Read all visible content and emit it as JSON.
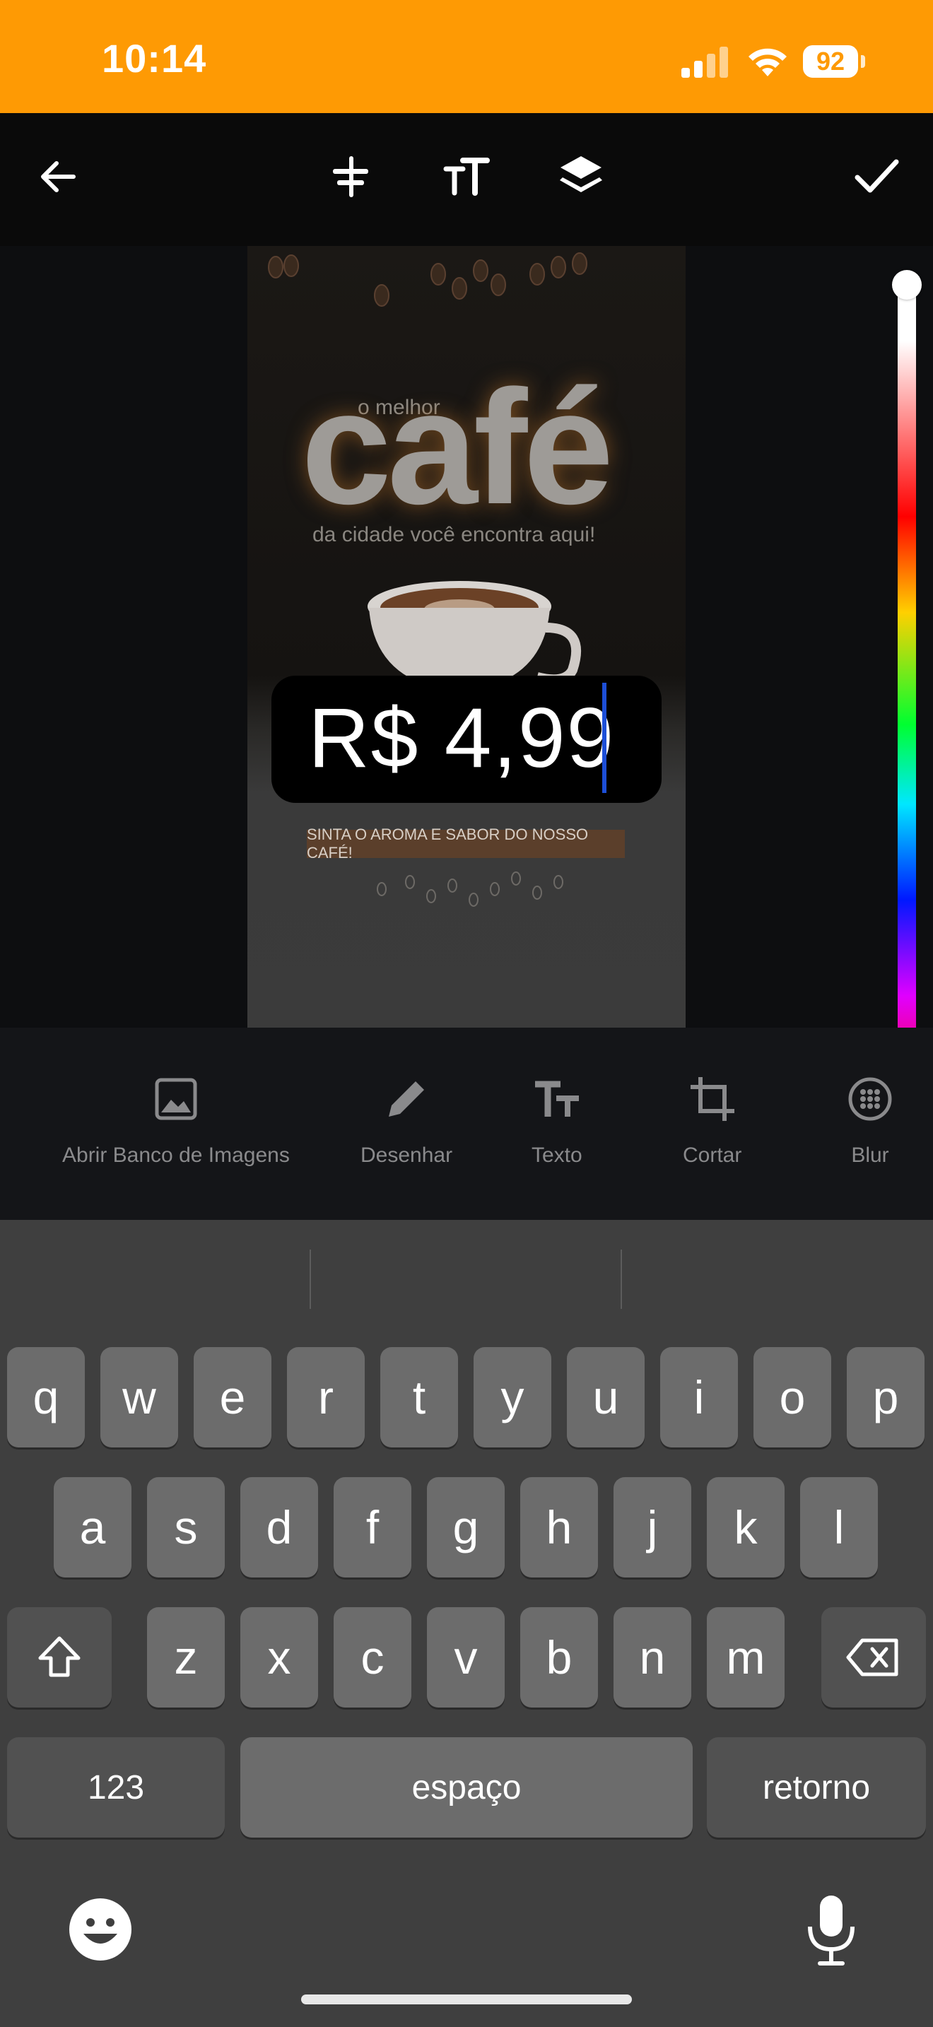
{
  "status": {
    "time": "10:14",
    "battery": "92"
  },
  "toolbar": {
    "back_icon": "arrow-left-icon",
    "align_icon": "align-center-icon",
    "text_size_icon": "text-size-icon",
    "layers_icon": "layers-icon",
    "done_icon": "checkmark-icon"
  },
  "poster": {
    "top_line": "o melhor",
    "headline": "café",
    "subline": "da cidade você encontra aqui!",
    "banner": "SINTA O AROMA E SABOR DO NOSSO CAFÉ!"
  },
  "text_box": {
    "value": "R$ 4,99",
    "background": "#000000",
    "text_color": "#ffffff"
  },
  "color_slider": {
    "selected_color": "#ffffff",
    "position_fraction": 0.0
  },
  "tools": [
    {
      "label": "Abrir Banco de Imagens",
      "icon": "image-icon"
    },
    {
      "label": "Desenhar",
      "icon": "pencil-icon"
    },
    {
      "label": "Texto",
      "icon": "text-icon"
    },
    {
      "label": "Cortar",
      "icon": "crop-icon"
    },
    {
      "label": "Blur",
      "icon": "blur-icon"
    }
  ],
  "keyboard": {
    "row1": [
      "q",
      "w",
      "e",
      "r",
      "t",
      "y",
      "u",
      "i",
      "o",
      "p"
    ],
    "row2": [
      "a",
      "s",
      "d",
      "f",
      "g",
      "h",
      "j",
      "k",
      "l"
    ],
    "row3": [
      "z",
      "x",
      "c",
      "v",
      "b",
      "n",
      "m"
    ],
    "numbers_key": "123",
    "space_key": "espaço",
    "return_key": "retorno",
    "shift_icon": "shift-icon",
    "delete_icon": "backspace-icon",
    "emoji_icon": "emoji-icon",
    "mic_icon": "microphone-icon"
  },
  "colors": {
    "status_bar": "#fe9a04",
    "caret": "#1d4fd8"
  }
}
